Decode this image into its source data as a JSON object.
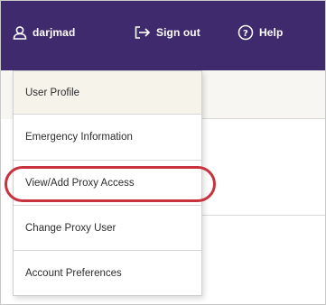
{
  "topbar": {
    "username": "darjmad",
    "signout_label": "Sign out",
    "help_label": "Help",
    "user_icon": "user-icon",
    "signout_icon": "sign-out-icon",
    "help_icon": "help-icon",
    "background_color": "#3f2a6e"
  },
  "menu": {
    "items": [
      {
        "label": "User Profile"
      },
      {
        "label": "Emergency Information"
      },
      {
        "label": "View/Add Proxy Access"
      },
      {
        "label": "Change Proxy User"
      },
      {
        "label": "Account Preferences"
      }
    ],
    "highlighted_item": "View/Add Proxy Access",
    "highlight_color": "#c8323c"
  }
}
